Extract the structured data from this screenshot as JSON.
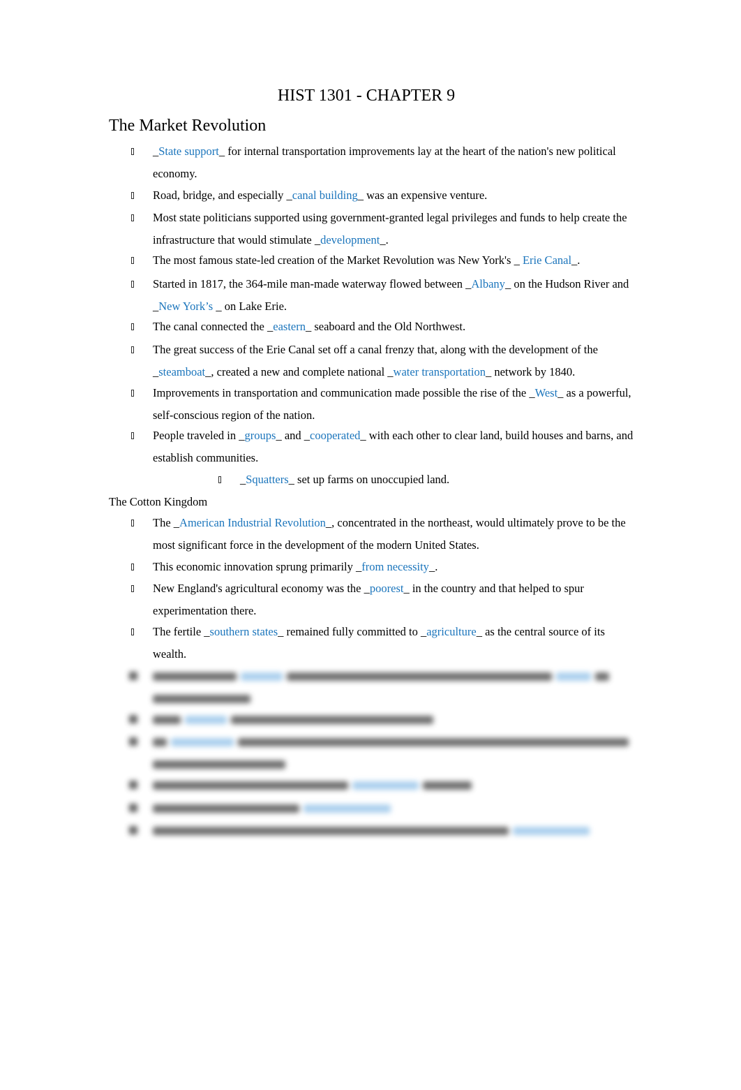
{
  "document": {
    "title": "HIST 1301 - CHAPTER 9",
    "sections": [
      {
        "heading": "The Market Revolution",
        "items": [
          {
            "parts": [
              {
                "t": "_"
              },
              {
                "b": "State support"
              },
              {
                "t": "_ for internal transportation improvements lay at the heart of the nation's new political economy."
              }
            ]
          },
          {
            "parts": [
              {
                "t": "Road, bridge, and especially _"
              },
              {
                "b": "canal building"
              },
              {
                "t": "_ was an expensive venture."
              }
            ]
          },
          {
            "parts": [
              {
                "t": " Most state politicians supported using government-granted legal privileges and funds to help create the infrastructure that would stimulate _"
              },
              {
                "b": "development"
              },
              {
                "t": "_."
              }
            ]
          },
          {
            "parts": [
              {
                "t": "The most famous state-led creation of the Market Revolution was New York's _ "
              },
              {
                "b": "Erie Canal"
              },
              {
                "t": "_."
              }
            ]
          },
          {
            "parts": [
              {
                "t": "Started in 1817, the 364-mile man-made waterway flowed between _"
              },
              {
                "b": "Albany"
              },
              {
                "t": "_ on the Hudson River and _"
              },
              {
                "b": "New York’s"
              },
              {
                "t": " _ on Lake Erie."
              }
            ]
          },
          {
            "parts": [
              {
                "t": "The canal connected the _"
              },
              {
                "b": "eastern"
              },
              {
                "t": "_ seaboard and the Old Northwest."
              }
            ]
          },
          {
            "parts": [
              {
                "t": "The great success of the Erie Canal set off a canal frenzy that, along with the development of the _"
              },
              {
                "b": "steamboat"
              },
              {
                "t": "_, created a new and complete national _"
              },
              {
                "b": "water transportation"
              },
              {
                "t": "_ network by 1840."
              }
            ]
          },
          {
            "parts": [
              {
                "t": "Improvements in transportation and communication made possible the rise of the _"
              },
              {
                "b": "West"
              },
              {
                "t": "_ as a powerful, self-conscious region of the nation."
              }
            ]
          },
          {
            "parts": [
              {
                "t": "People traveled in _"
              },
              {
                "b": "groups"
              },
              {
                "t": "_ and _"
              },
              {
                "b": "cooperated"
              },
              {
                "t": "_ with each other to clear land, build houses and barns, and establish communities."
              }
            ]
          },
          {
            "sub": true,
            "parts": [
              {
                "t": "_"
              },
              {
                "b": "Squatters"
              },
              {
                "t": "_ set up farms on unoccupied land."
              }
            ]
          }
        ]
      },
      {
        "heading": "The Cotton Kingdom",
        "items": [
          {
            "parts": [
              {
                "t": "The _"
              },
              {
                "b": "American Industrial Revolution"
              },
              {
                "t": "_, concentrated in the northeast, would ultimately prove to be the most significant force in the development of the modern United States."
              }
            ]
          },
          {
            "parts": [
              {
                "t": " This economic innovation sprung primarily _"
              },
              {
                "b": "from necessity"
              },
              {
                "t": "_."
              }
            ]
          },
          {
            "parts": [
              {
                "t": " New England's agricultural economy was the _"
              },
              {
                "b": "poorest"
              },
              {
                "t": "_ in the country and that helped to spur experimentation there."
              }
            ]
          },
          {
            "parts": [
              {
                "t": "The fertile _"
              },
              {
                "b": "southern states"
              },
              {
                "t": "_ remained fully committed to _"
              },
              {
                "b": "agriculture"
              },
              {
                "t": "_ as the central source of its wealth."
              }
            ]
          }
        ],
        "blurred_item_count": 6
      }
    ]
  },
  "colors": {
    "answer_blue": "#1b75bc",
    "text": "#000000"
  }
}
